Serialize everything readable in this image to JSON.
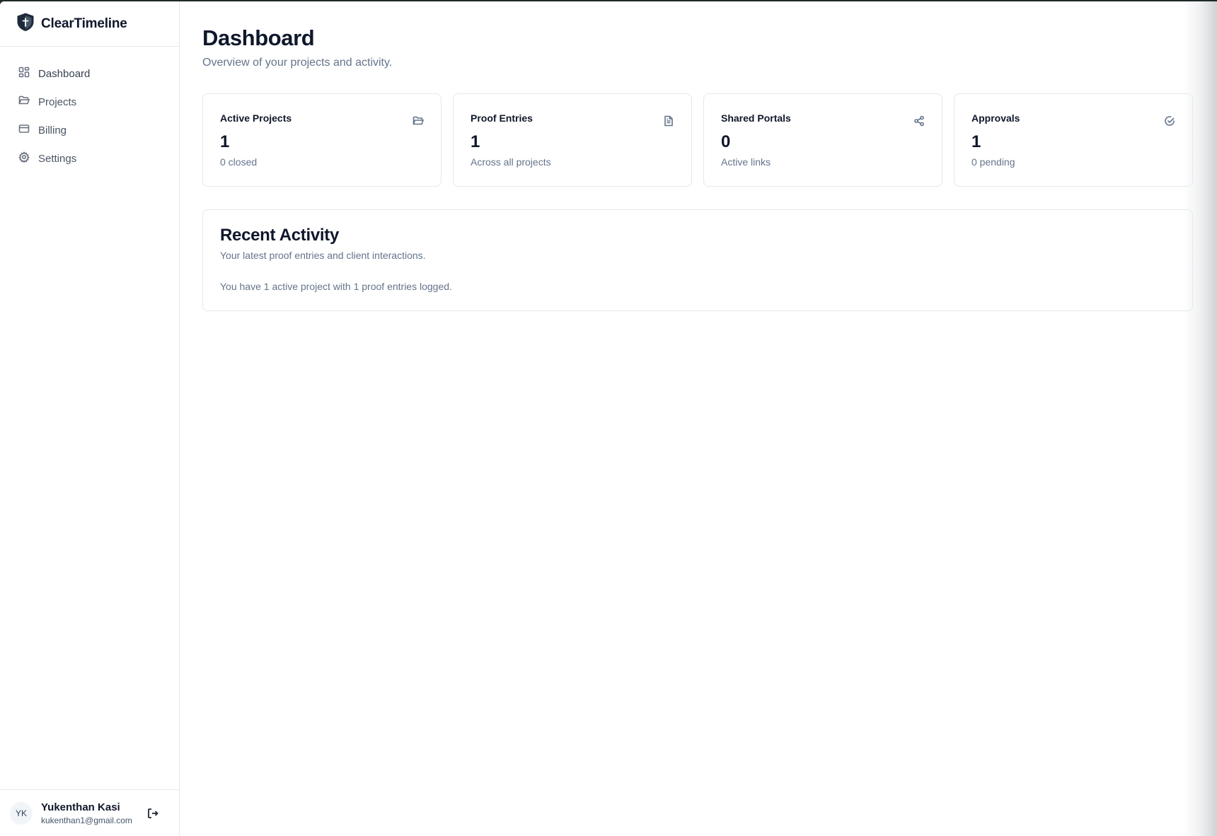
{
  "app": {
    "name": "ClearTimeline"
  },
  "sidebar": {
    "items": [
      {
        "label": "Dashboard",
        "icon": "layout-dashboard-icon"
      },
      {
        "label": "Projects",
        "icon": "folder-open-icon"
      },
      {
        "label": "Billing",
        "icon": "credit-card-icon"
      },
      {
        "label": "Settings",
        "icon": "gear-icon"
      }
    ]
  },
  "user": {
    "initials": "YK",
    "name": "Yukenthan Kasi",
    "email": "kukenthan1@gmail.com"
  },
  "header": {
    "title": "Dashboard",
    "subtitle": "Overview of your projects and activity."
  },
  "stats": [
    {
      "title": "Active Projects",
      "value": "1",
      "sub": "0 closed",
      "icon": "folder-open-icon"
    },
    {
      "title": "Proof Entries",
      "value": "1",
      "sub": "Across all projects",
      "icon": "file-text-icon"
    },
    {
      "title": "Shared Portals",
      "value": "0",
      "sub": "Active links",
      "icon": "share-icon"
    },
    {
      "title": "Approvals",
      "value": "1",
      "sub": "0 pending",
      "icon": "check-circle-icon"
    }
  ],
  "activity": {
    "title": "Recent Activity",
    "subtitle": "Your latest proof entries and client interactions.",
    "text": "You have 1 active project with 1 proof entries logged."
  }
}
